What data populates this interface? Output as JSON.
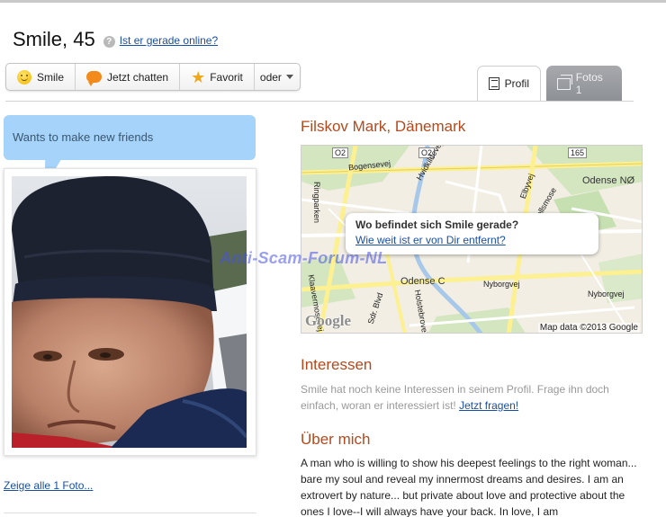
{
  "profile": {
    "name_age": "Smile, 45",
    "online_link": "Ist er gerade online?",
    "help_icon": "question-icon",
    "status_bubble": "Wants to make new friends",
    "show_all_photos": "Zeige alle 1 Foto..."
  },
  "actions": {
    "smile": "Smile",
    "chat": "Jetzt chatten",
    "favorite": "Favorit",
    "more": "oder"
  },
  "tabs": {
    "profile": "Profil",
    "photos": "Fotos 1"
  },
  "location": {
    "heading": "Filskov Mark, Dänemark",
    "popup_question": "Wo befindet sich Smile gerade?",
    "popup_link": "Wie weit ist er von Dir entfernt?",
    "credit": "Map data ©2013 Google",
    "google_logo": "Google",
    "labels": [
      "O2",
      "Bogensevej",
      "O2",
      "Ringparken",
      "Odense NØ",
      "165",
      "Odense C",
      "Nyborgvej",
      "Nyborgvej",
      "Klaavermosevej",
      "Sdr. Blvd",
      "Holstebrovej",
      "Elbyvej",
      "Vollsmose",
      "Hvidkildevej"
    ]
  },
  "interests": {
    "heading": "Interessen",
    "text": "Smile hat noch keine Interessen in seinem Profil. Frage ihn doch einfach, woran er interessiert ist!",
    "link": "Jetzt fragen!"
  },
  "about": {
    "heading": "Über mich",
    "text": "A man who is willing to show his deepest feelings to the right woman... bare my soul and reveal my innermost dreams and desires. I am an extrovert by nature... but private about love and protective about the ones I love--I will always have your back. In love, I am"
  },
  "watermark": "Anti-Scam-Forum-NL",
  "colors": {
    "accent_heading": "#b3491d",
    "link": "#1a4fa0",
    "bubble": "#a6d3f9"
  }
}
